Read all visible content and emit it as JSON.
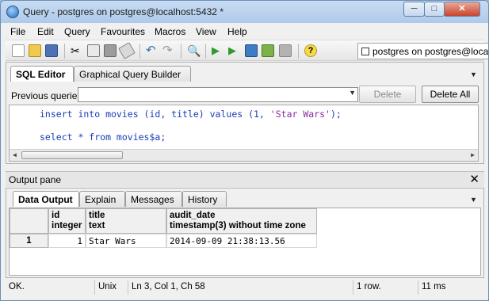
{
  "window": {
    "title": "Query - postgres on postgres@localhost:5432 *",
    "controls": {
      "minimize": "─",
      "maximize": "□",
      "close": "✕"
    }
  },
  "menubar": [
    "File",
    "Edit",
    "Query",
    "Favourites",
    "Macros",
    "View",
    "Help"
  ],
  "toolbar": {
    "icons": [
      "new-file-icon",
      "open-folder-icon",
      "save-icon",
      "cut-icon",
      "copy-icon",
      "paste-icon",
      "clear-icon",
      "undo-icon",
      "redo-icon",
      "find-icon",
      "execute-icon",
      "execute-pgscript-icon",
      "execute-to-file-icon",
      "explain-icon",
      "cancel-icon",
      "help-icon"
    ],
    "connection": "postgres on postgres@localhost"
  },
  "editor": {
    "tabs": [
      "SQL Editor",
      "Graphical Query Builder"
    ],
    "previous_label": "Previous queries",
    "previous_value": "",
    "delete_label": "Delete",
    "delete_all_label": "Delete All",
    "sql_lines": [
      {
        "code": "insert into movies (id, title) values (1, ",
        "str": "'Star Wars'",
        "end": ");"
      },
      {
        "code": "select * from movies$a;",
        "str": "",
        "end": ""
      }
    ]
  },
  "output": {
    "title": "Output pane",
    "close": "✕",
    "tabs": [
      "Data Output",
      "Explain",
      "Messages",
      "History"
    ],
    "columns": [
      {
        "name": "id",
        "type": "integer"
      },
      {
        "name": "title",
        "type": "text"
      },
      {
        "name": "audit_date",
        "type": "timestamp(3) without time zone"
      }
    ],
    "rows": [
      {
        "num": "1",
        "cells": [
          "1",
          "Star Wars",
          "2014-09-09 21:38:13.56"
        ]
      }
    ]
  },
  "status": {
    "message": "OK.",
    "line_ending": "Unix",
    "position": "Ln 3, Col 1, Ch 58",
    "rows": "1 row.",
    "time": "11 ms"
  }
}
